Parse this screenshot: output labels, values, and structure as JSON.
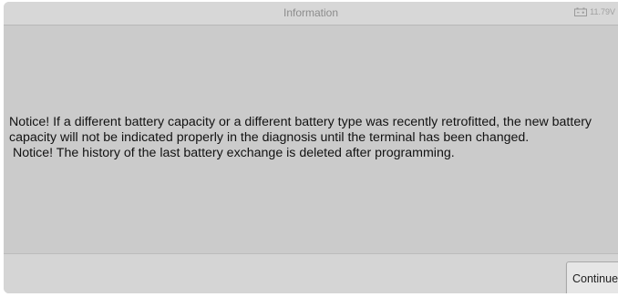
{
  "window": {
    "title": "Information"
  },
  "status": {
    "battery_icon": "battery-icon",
    "battery_voltage": "11.79V"
  },
  "message": {
    "line1": "Notice! If a different battery capacity or a different battery type was recently retrofitted, the new battery capacity will not be indicated properly in the diagnosis until the terminal has been changed.",
    "line2": " Notice! The history of the last battery exchange is deleted after programming."
  },
  "footer": {
    "continue_label": "Continue"
  },
  "colors": {
    "background": "#cbcbcb",
    "title_bar": "#d7d7d7",
    "text": "#121212"
  }
}
